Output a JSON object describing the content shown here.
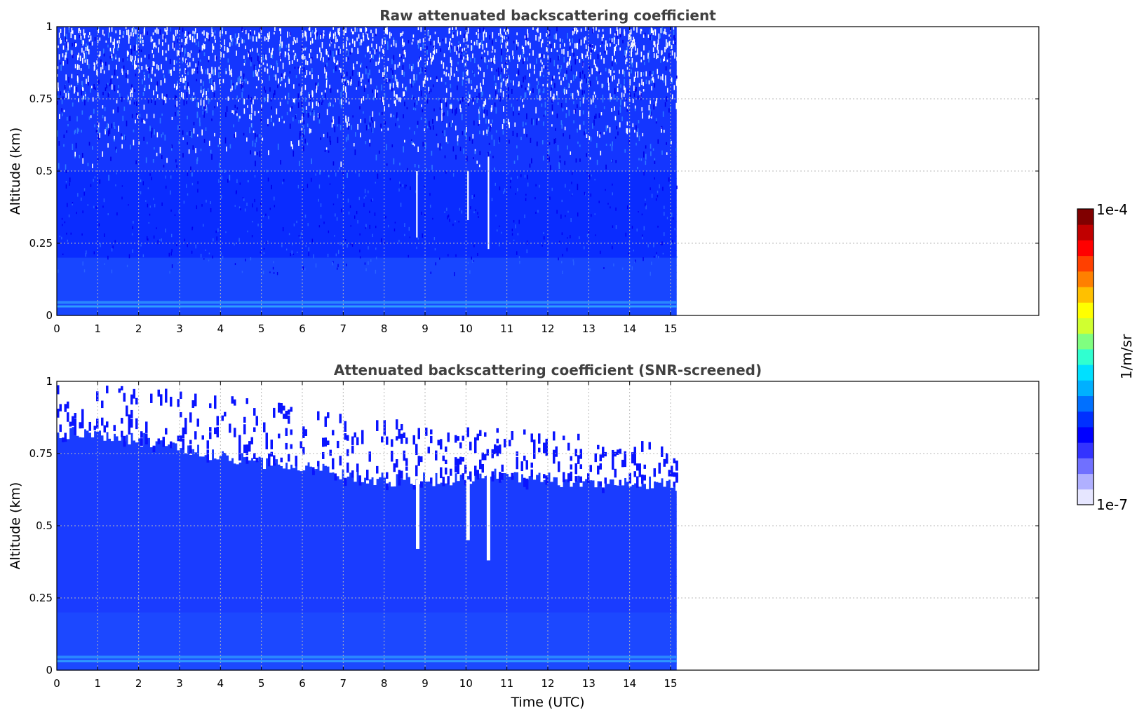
{
  "chart_data": [
    {
      "type": "heatmap",
      "title": "Raw attenuated backscattering coefficient",
      "xlabel": "",
      "ylabel": "Altitude (km)",
      "xlim": [
        0,
        24
      ],
      "ylim": [
        0,
        1
      ],
      "data_end_x": 15.15,
      "x_ticks": [
        0,
        1,
        2,
        3,
        4,
        5,
        6,
        7,
        8,
        9,
        10,
        11,
        12,
        13,
        14,
        15
      ],
      "x_tick_labels": [
        "0",
        "1",
        "2",
        "3",
        "4",
        "5",
        "6",
        "7",
        "8",
        "9",
        "10",
        "11",
        "12",
        "13",
        "14",
        "15"
      ],
      "y_ticks": [
        0,
        0.25,
        0.5,
        0.75,
        1
      ],
      "y_tick_labels": [
        "0",
        "0.25",
        "0.5",
        "0.75",
        "1"
      ],
      "grid": true,
      "noise_onset_altitude": 0.45,
      "features": [
        {
          "x": 8.8,
          "ymin": 0.27,
          "ymax": 0.5
        },
        {
          "x": 10.05,
          "ymin": 0.33,
          "ymax": 0.5
        },
        {
          "x": 10.55,
          "ymin": 0.23,
          "ymax": 0.55
        }
      ]
    },
    {
      "type": "heatmap",
      "title": "Attenuated backscattering coefficient (SNR-screened)",
      "xlabel": "Time (UTC)",
      "ylabel": "Altitude (km)",
      "xlim": [
        0,
        24
      ],
      "ylim": [
        0,
        1
      ],
      "data_end_x": 15.15,
      "x_ticks": [
        0,
        1,
        2,
        3,
        4,
        5,
        6,
        7,
        8,
        9,
        10,
        11,
        12,
        13,
        14,
        15
      ],
      "x_tick_labels": [
        "0",
        "1",
        "2",
        "3",
        "4",
        "5",
        "6",
        "7",
        "8",
        "9",
        "10",
        "11",
        "12",
        "13",
        "14",
        "15"
      ],
      "y_ticks": [
        0,
        0.25,
        0.5,
        0.75,
        1
      ],
      "y_tick_labels": [
        "0",
        "0.25",
        "0.5",
        "0.75",
        "1"
      ],
      "grid": true,
      "screen_top_profile": {
        "x": [
          0,
          1,
          2,
          3,
          4,
          5,
          6,
          7,
          8,
          9,
          10,
          11,
          12,
          13,
          14,
          15.15
        ],
        "y": [
          0.82,
          0.82,
          0.8,
          0.77,
          0.74,
          0.72,
          0.7,
          0.68,
          0.66,
          0.66,
          0.66,
          0.68,
          0.66,
          0.65,
          0.65,
          0.64
        ]
      },
      "features": [
        {
          "x": 8.82,
          "ymin": 0.42,
          "ymax": 0.66
        },
        {
          "x": 10.05,
          "ymin": 0.45,
          "ymax": 0.66
        },
        {
          "x": 10.55,
          "ymin": 0.38,
          "ymax": 0.68
        }
      ]
    }
  ],
  "colorbar": {
    "label": "1/m/sr",
    "min_label": "1e-7",
    "max_label": "1e-4",
    "scale": "log",
    "colors": [
      "#e6e6ff",
      "#b0b0ff",
      "#7070ff",
      "#3333ff",
      "#0000ff",
      "#0030ff",
      "#0070ff",
      "#00b0ff",
      "#00e0ff",
      "#30ffd0",
      "#80ff80",
      "#d0ff30",
      "#ffff00",
      "#ffc000",
      "#ff8000",
      "#ff4000",
      "#ff0000",
      "#c00000",
      "#800000"
    ]
  }
}
